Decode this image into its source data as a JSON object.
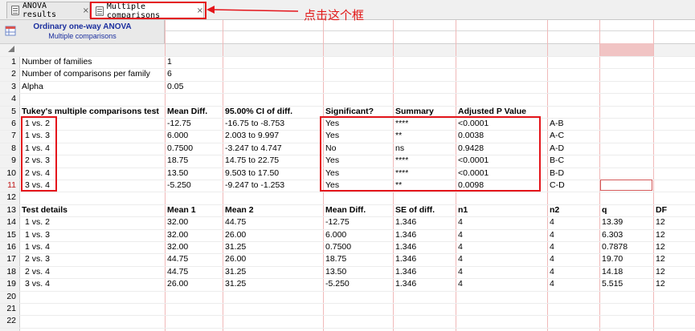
{
  "tabs": [
    {
      "label": "ANOVA results",
      "close": "×"
    },
    {
      "label": "Multiple comparisons",
      "close": "×"
    }
  ],
  "annotation": {
    "text": "点击这个框",
    "color": "#e11818"
  },
  "header": {
    "title": "Ordinary one-way ANOVA",
    "subtitle": "Multiple comparisons"
  },
  "row_numbers": [
    "1",
    "2",
    "3",
    "4",
    "5",
    "6",
    "7",
    "8",
    "9",
    "10",
    "11",
    "12",
    "13",
    "14",
    "15",
    "16",
    "17",
    "18",
    "19",
    "20",
    "21",
    "22"
  ],
  "summary": [
    {
      "label": "Number of families",
      "value": "1"
    },
    {
      "label": "Number of comparisons per family",
      "value": "6"
    },
    {
      "label": "Alpha",
      "value": "0.05"
    }
  ],
  "tukey": {
    "headers": [
      "Tukey's multiple comparisons test",
      "Mean Diff.",
      "95.00% CI of diff.",
      "Significant?",
      "Summary",
      "Adjusted P Value"
    ],
    "rows": [
      [
        "1 vs. 2",
        "-12.75",
        "-16.75 to -8.753",
        "Yes",
        "****",
        "<0.0001",
        "A-B"
      ],
      [
        "1 vs. 3",
        "6.000",
        "2.003 to 9.997",
        "Yes",
        "**",
        "0.0038",
        "A-C"
      ],
      [
        "1 vs. 4",
        "0.7500",
        "-3.247 to 4.747",
        "No",
        "ns",
        "0.9428",
        "A-D"
      ],
      [
        "2 vs. 3",
        "18.75",
        "14.75 to 22.75",
        "Yes",
        "****",
        "<0.0001",
        "B-C"
      ],
      [
        "2 vs. 4",
        "13.50",
        "9.503 to 17.50",
        "Yes",
        "****",
        "<0.0001",
        "B-D"
      ],
      [
        "3 vs. 4",
        "-5.250",
        "-9.247 to -1.253",
        "Yes",
        "**",
        "0.0098",
        "C-D"
      ]
    ]
  },
  "details": {
    "headers": [
      "Test details",
      "Mean 1",
      "Mean 2",
      "Mean Diff.",
      "SE of diff.",
      "n1",
      "n2",
      "q",
      "DF"
    ],
    "rows": [
      [
        "1 vs. 2",
        "32.00",
        "44.75",
        "-12.75",
        "1.346",
        "4",
        "4",
        "13.39",
        "12"
      ],
      [
        "1 vs. 3",
        "32.00",
        "26.00",
        "6.000",
        "1.346",
        "4",
        "4",
        "6.303",
        "12"
      ],
      [
        "1 vs. 4",
        "32.00",
        "31.25",
        "0.7500",
        "1.346",
        "4",
        "4",
        "0.7878",
        "12"
      ],
      [
        "2 vs. 3",
        "44.75",
        "26.00",
        "18.75",
        "1.346",
        "4",
        "4",
        "19.70",
        "12"
      ],
      [
        "2 vs. 4",
        "44.75",
        "31.25",
        "13.50",
        "1.346",
        "4",
        "4",
        "14.18",
        "12"
      ],
      [
        "3 vs. 4",
        "26.00",
        "31.25",
        "-5.250",
        "1.346",
        "4",
        "4",
        "5.515",
        "12"
      ]
    ]
  },
  "colors": {
    "accent_red": "#e4151b",
    "header_blue": "#1b2f9e",
    "grid_line": "#f0b9b9"
  }
}
